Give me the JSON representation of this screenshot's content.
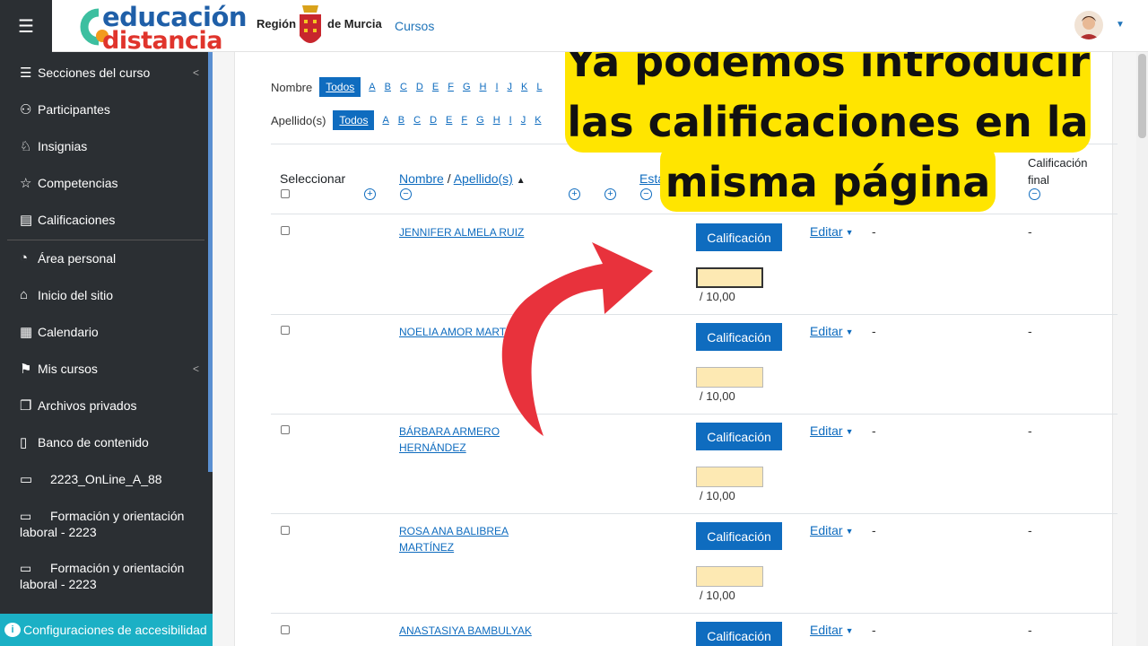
{
  "header": {
    "logo_top": "educación",
    "logo_bottom": "distancia",
    "region_left": "Región",
    "region_right": "de Murcia",
    "nav_courses": "Cursos"
  },
  "sidebar": {
    "items": [
      {
        "label": "Secciones del curso",
        "icon": "list-icon"
      },
      {
        "label": "Participantes",
        "icon": "users-icon"
      },
      {
        "label": "Insignias",
        "icon": "badge-icon"
      },
      {
        "label": "Competencias",
        "icon": "star-icon"
      },
      {
        "label": "Calificaciones",
        "icon": "table-icon"
      },
      {
        "label": "Área personal",
        "icon": "dashboard-icon"
      },
      {
        "label": "Inicio del sitio",
        "icon": "home-icon"
      },
      {
        "label": "Calendario",
        "icon": "calendar-icon"
      },
      {
        "label": "Mis cursos",
        "icon": "graduation-cap-icon"
      },
      {
        "label": "Archivos privados",
        "icon": "files-icon"
      },
      {
        "label": "Banco de contenido",
        "icon": "clipboard-icon"
      },
      {
        "label": "2223_OnLine_A_88",
        "icon": "folder-icon"
      },
      {
        "label": "Formación y orientación laboral - 2223",
        "icon": "folder-icon"
      },
      {
        "label": "Formación y orientación laboral - 2223",
        "icon": "folder-icon"
      }
    ],
    "accessibility": "Configuraciones de accesibilidad"
  },
  "filters": {
    "first_name_label": "Nombre",
    "last_name_label": "Apellido(s)",
    "all_label": "Todos",
    "first_letters": [
      "A",
      "B",
      "C",
      "D",
      "E",
      "F",
      "G",
      "H",
      "I",
      "J",
      "K",
      "L"
    ],
    "last_letters": [
      "A",
      "B",
      "C",
      "D",
      "E",
      "F",
      "G",
      "H",
      "I",
      "J",
      "K"
    ]
  },
  "table": {
    "col_select": "Seleccionar",
    "col_name": "Nombre",
    "col_name_sep": "/",
    "col_surname": "Apellido(s)",
    "col_status": "Estado",
    "col_final_line1": "Calificación",
    "col_final_line2": "final",
    "grade_button": "Calificación",
    "edit_label": "Editar",
    "grade_max": "/ 10,00",
    "empty": "-",
    "students": [
      {
        "name": "JENNIFER ALMELA RUIZ"
      },
      {
        "name": "NOELIA AMOR MARTÍNEZ"
      },
      {
        "name": "BÁRBARA ARMERO HERNÁNDEZ"
      },
      {
        "name": "ROSA ANA BALIBREA MARTÍNEZ"
      },
      {
        "name": "ANASTASIYA BAMBULYAK"
      }
    ]
  },
  "callout": {
    "line1": "Ya podemos introducir",
    "line2": "las calificaciones en la",
    "line3": "misma página"
  },
  "colors": {
    "primary": "#0f6cbf",
    "sidebar_bg": "#2b2f33",
    "callout_bg": "#ffe500",
    "arrow": "#e8323c",
    "grade_input_bg": "#fde9b3"
  }
}
